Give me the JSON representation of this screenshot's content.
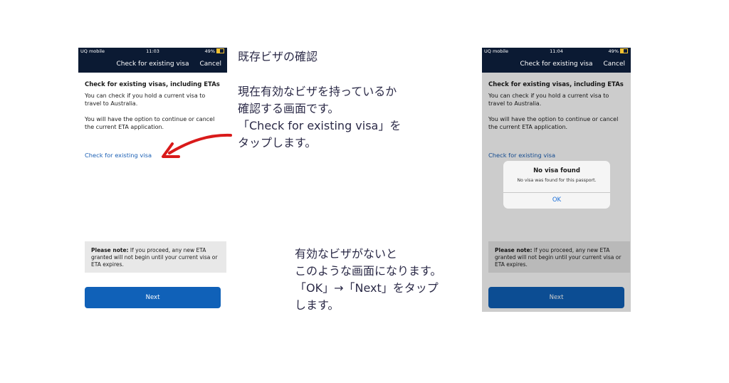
{
  "phone_left": {
    "status": {
      "carrier": "UQ mobile",
      "time": "11:03",
      "battery": "49%"
    },
    "nav": {
      "title": "Check for existing visa",
      "cancel": "Cancel"
    },
    "heading": "Check for existing visas, including ETAs",
    "para1": "You can check if you hold a current visa to travel to Australia.",
    "para2": "You will have the option to continue or cancel the current ETA application.",
    "link": "Check for existing visa",
    "note_bold": "Please note:",
    "note_text": " If you proceed, any new ETA granted will not begin until your current visa or ETA expires.",
    "next": "Next"
  },
  "phone_right": {
    "status": {
      "carrier": "UQ mobile",
      "time": "11:04",
      "battery": "49%"
    },
    "nav": {
      "title": "Check for existing visa",
      "cancel": "Cancel"
    },
    "heading": "Check for existing visas, including ETAs",
    "para1": "You can check if you hold a current visa to travel to Australia.",
    "para2": "You will have the option to continue or cancel the current ETA application.",
    "link": "Check for existing visa",
    "note_bold": "Please note:",
    "note_text": " If you proceed, any new ETA granted will not begin until your current visa or ETA expires.",
    "next": "Next",
    "alert": {
      "title": "No visa found",
      "message": "No visa was found for this passport.",
      "ok": "OK"
    }
  },
  "annotations": {
    "title": "既存ビザの確認",
    "desc1": [
      "現在有効なビザを持っているか",
      "確認する画面です。",
      "「Check for existing visa」を",
      "タップします。"
    ],
    "desc2": [
      "有効なビザがないと",
      "このような画面になります。",
      "「OK」→「Next」をタップ",
      "します。"
    ]
  },
  "colors": {
    "navbar": "#0b1a33",
    "button": "#1061b8",
    "link": "#1a5fb4",
    "arrow": "#d91a1a",
    "annotation_text": "#2b2a47"
  }
}
